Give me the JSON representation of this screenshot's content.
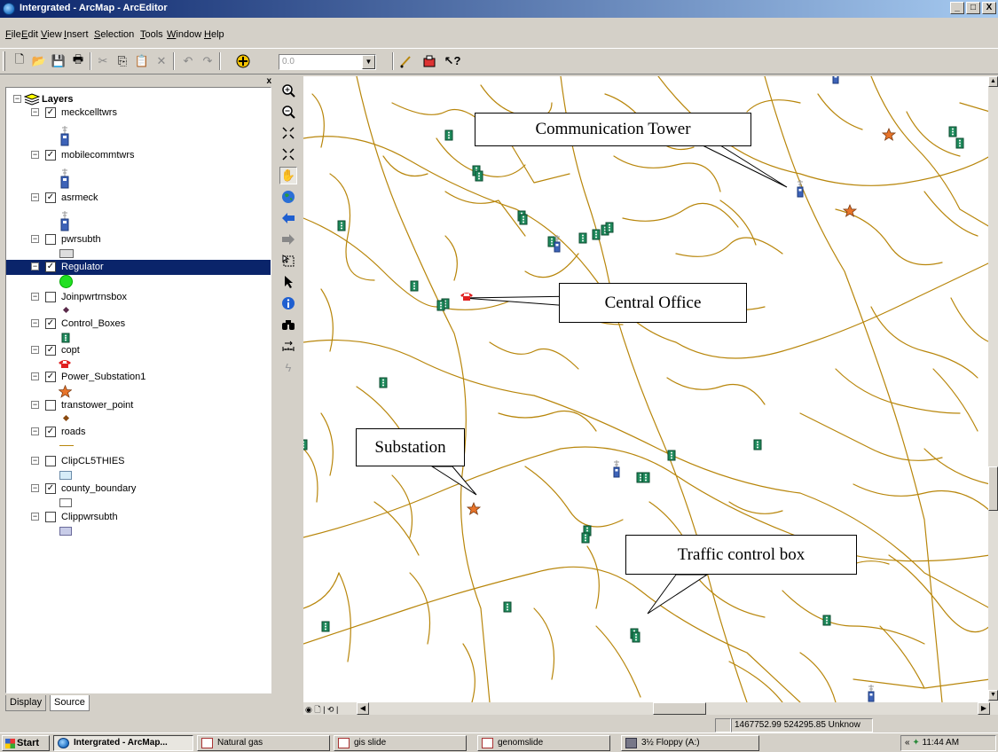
{
  "window": {
    "title": "Intergrated - ArcMap - ArcEditor",
    "min": "_",
    "max": "□",
    "close": "X"
  },
  "menu": [
    {
      "hot": "F",
      "rest": "ile"
    },
    {
      "hot": "E",
      "rest": "dit"
    },
    {
      "hot": "V",
      "rest": "iew"
    },
    {
      "hot": "I",
      "rest": "nsert"
    },
    {
      "hot": "S",
      "rest": "election"
    },
    {
      "hot": "T",
      "rest": "ools"
    },
    {
      "hot": "W",
      "rest": "indow"
    },
    {
      "hot": "H",
      "rest": "elp"
    }
  ],
  "toolbar": {
    "scale_value": "0.0"
  },
  "toc": {
    "root_label": "Layers",
    "close": "x",
    "layers": [
      {
        "name": "meckcelltwrs",
        "checked": true,
        "symbol": "tower-icon"
      },
      {
        "name": "mobilecommtwrs",
        "checked": true,
        "symbol": "tower-icon"
      },
      {
        "name": "asrmeck",
        "checked": true,
        "symbol": "tower-icon"
      },
      {
        "name": "pwrsubth",
        "checked": false,
        "symbol": "gray-box-symbol"
      },
      {
        "name": "Regulator",
        "checked": true,
        "symbol": "green-circle-symbol",
        "selected": true
      },
      {
        "name": "Joinpwrtrnsbox",
        "checked": false,
        "symbol": "small-diamond-symbol"
      },
      {
        "name": "Control_Boxes",
        "checked": true,
        "symbol": "traffic-light-icon"
      },
      {
        "name": "copt",
        "checked": true,
        "symbol": "red-phone-icon"
      },
      {
        "name": "Power_Substation1",
        "checked": true,
        "symbol": "orange-star-icon"
      },
      {
        "name": "transtower_point",
        "checked": false,
        "symbol": "small-diamond-symbol"
      },
      {
        "name": "roads",
        "checked": true,
        "symbol": "road-line-symbol"
      },
      {
        "name": "ClipCL5THIES",
        "checked": false,
        "symbol": "light-blue-box-symbol"
      },
      {
        "name": "county_boundary",
        "checked": true,
        "symbol": "white-box-symbol"
      },
      {
        "name": "Clippwrsubth",
        "checked": false,
        "symbol": "blue-gray-box-symbol"
      }
    ],
    "tabs": [
      "Display",
      "Source"
    ]
  },
  "map": {
    "road_color": "#b8860b",
    "callouts": [
      "Communication Tower",
      "Central Office",
      "Substation",
      "Traffic control box"
    ]
  },
  "status": {
    "coordinates": "1467752.99  524295.85 Unknow"
  },
  "taskbar": {
    "start": "Start",
    "tasks": [
      "Intergrated - ArcMap...",
      "Natural gas",
      "gis slide",
      "genomslide",
      "3½ Floppy (A:)"
    ],
    "tray_arrows": "«",
    "clock": "11:44 AM"
  }
}
